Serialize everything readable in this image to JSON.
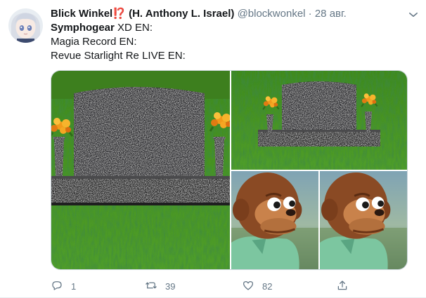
{
  "tweet": {
    "author": {
      "name": "Blick Winkel",
      "name_emoji": "⁉️",
      "name_suffix": "(H. Anthony L. Israel)",
      "handle": "@blockwonkel",
      "separator": "·",
      "date": "28 авг."
    },
    "text": {
      "line1_bold": "Symphogear",
      "line1_rest": " XD EN:",
      "line2": "Magia Record EN:",
      "line3": "Revue Starlight Re LIVE EN:"
    },
    "media": [
      {
        "name": "gravestone-large",
        "depicts": "grave-headstone-with-flowers"
      },
      {
        "name": "gravestone-small",
        "depicts": "grave-headstone-with-flowers"
      },
      {
        "name": "puppet-look-away-1",
        "depicts": "monkey-puppet-side-eye"
      },
      {
        "name": "puppet-look-away-2",
        "depicts": "monkey-puppet-side-eye"
      }
    ],
    "actions": {
      "reply_count": "1",
      "retweet_count": "39",
      "like_count": "82",
      "share_count": ""
    }
  },
  "colors": {
    "text": "#14171a",
    "muted": "#657786",
    "border": "#e6ecf0",
    "emoji": "#e0245e"
  },
  "icons": [
    "avatar",
    "chevron-down-icon",
    "reply-icon",
    "retweet-icon",
    "like-icon",
    "share-icon"
  ]
}
